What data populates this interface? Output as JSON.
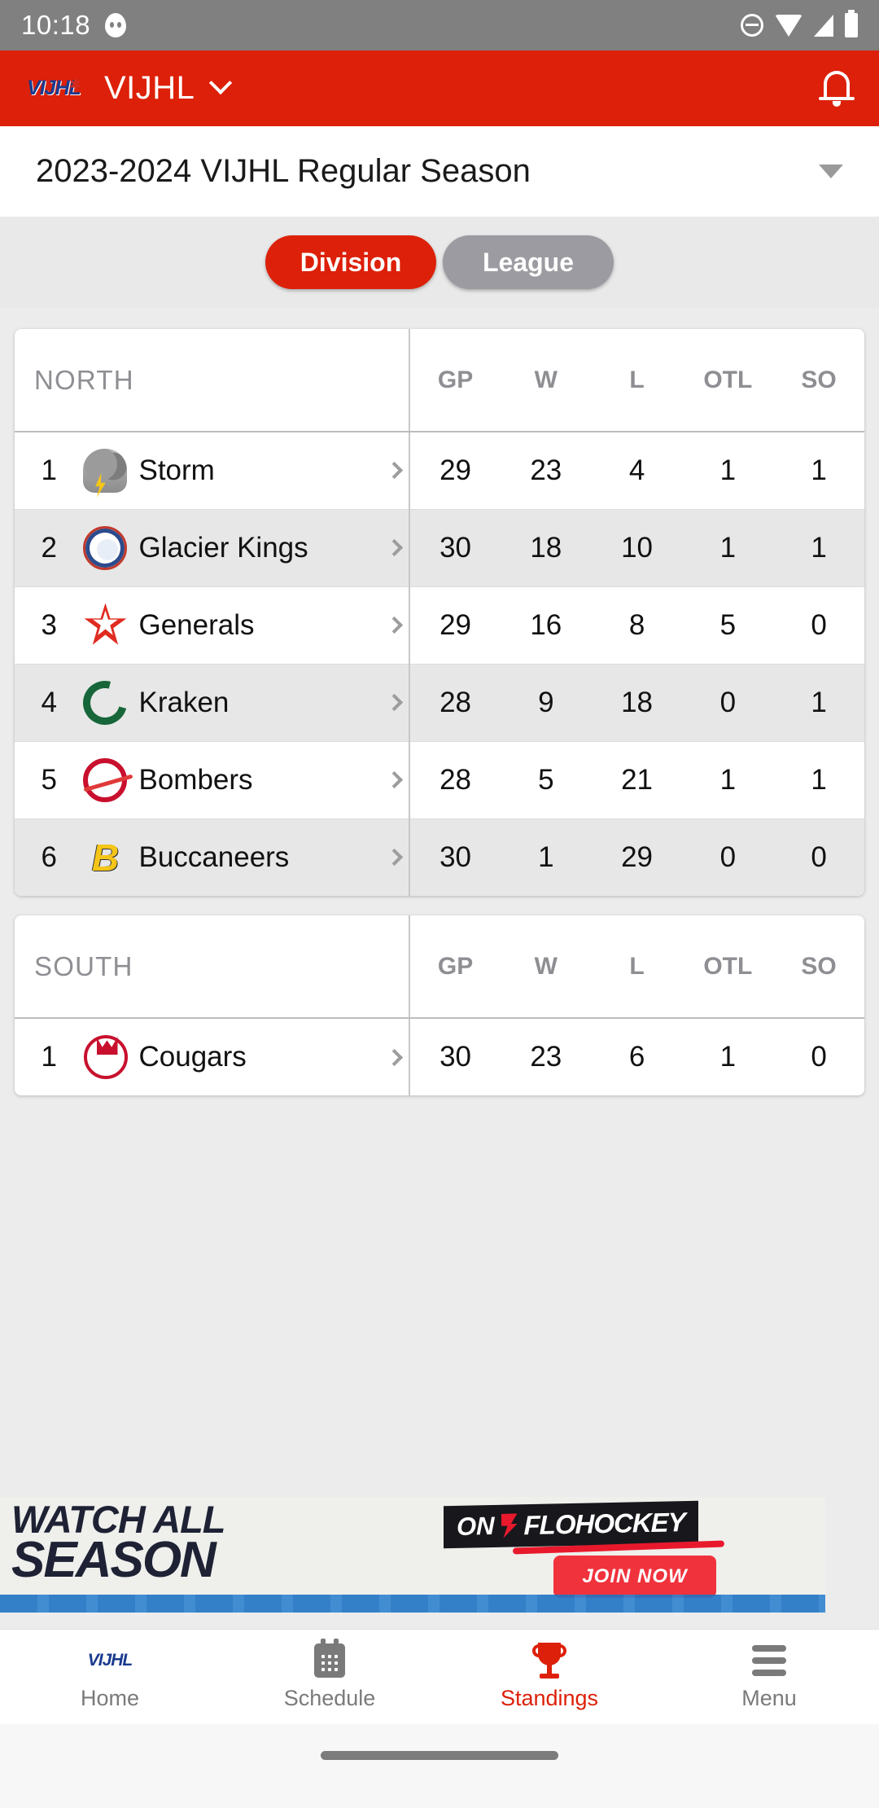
{
  "status_bar": {
    "time": "10:18",
    "icons": [
      "ghost-icon",
      "do-not-disturb-icon",
      "wifi-icon",
      "cellular-signal-icon",
      "battery-icon"
    ]
  },
  "app_bar": {
    "logo": "vijhl-logo",
    "logo_text": "VIJHL",
    "title": "VIJHL",
    "dropdown_icon": "chevron-down-icon",
    "notification_icon": "bell-icon"
  },
  "season_selector": {
    "value": "2023-2024 VIJHL Regular Season",
    "dropdown_icon": "caret-down-icon"
  },
  "view_toggle": {
    "options": [
      {
        "label": "Division",
        "active": true
      },
      {
        "label": "League",
        "active": false
      }
    ],
    "active_color": "#dd2009",
    "inactive_color": "#9b9ba1"
  },
  "standings": {
    "columns": [
      "GP",
      "W",
      "L",
      "OTL",
      "SO"
    ],
    "divisions": [
      {
        "name": "NORTH",
        "teams": [
          {
            "rank": "1",
            "name": "Storm",
            "logo": "storm-logo",
            "gp": "29",
            "w": "23",
            "l": "4",
            "otl": "1",
            "so": "1"
          },
          {
            "rank": "2",
            "name": "Glacier Kings",
            "logo": "glacier-kings-logo",
            "gp": "30",
            "w": "18",
            "l": "10",
            "otl": "1",
            "so": "1"
          },
          {
            "rank": "3",
            "name": "Generals",
            "logo": "generals-logo",
            "gp": "29",
            "w": "16",
            "l": "8",
            "otl": "5",
            "so": "0"
          },
          {
            "rank": "4",
            "name": "Kraken",
            "logo": "kraken-logo",
            "gp": "28",
            "w": "9",
            "l": "18",
            "otl": "0",
            "so": "1"
          },
          {
            "rank": "5",
            "name": "Bombers",
            "logo": "bombers-logo",
            "gp": "28",
            "w": "5",
            "l": "21",
            "otl": "1",
            "so": "1"
          },
          {
            "rank": "6",
            "name": "Buccaneers",
            "logo": "buccaneers-logo",
            "gp": "30",
            "w": "1",
            "l": "29",
            "otl": "0",
            "so": "0"
          }
        ]
      },
      {
        "name": "SOUTH",
        "teams": [
          {
            "rank": "1",
            "name": "Cougars",
            "logo": "cougars-logo",
            "gp": "30",
            "w": "23",
            "l": "6",
            "otl": "1",
            "so": "0"
          }
        ]
      }
    ]
  },
  "advertisement": {
    "line1": "WATCH ALL",
    "line2": "SEASON",
    "badge_prefix": "ON",
    "badge_brand": "FLOHOCKEY",
    "cta_label": "JOIN NOW",
    "cta_color": "#f0323c"
  },
  "bottom_nav": {
    "items": [
      {
        "label": "Home",
        "icon": "vijhl-logo-icon",
        "active": false
      },
      {
        "label": "Schedule",
        "icon": "calendar-icon",
        "active": false
      },
      {
        "label": "Standings",
        "icon": "trophy-icon",
        "active": true
      },
      {
        "label": "Menu",
        "icon": "hamburger-icon",
        "active": false
      }
    ],
    "active_color": "#dd2009"
  }
}
